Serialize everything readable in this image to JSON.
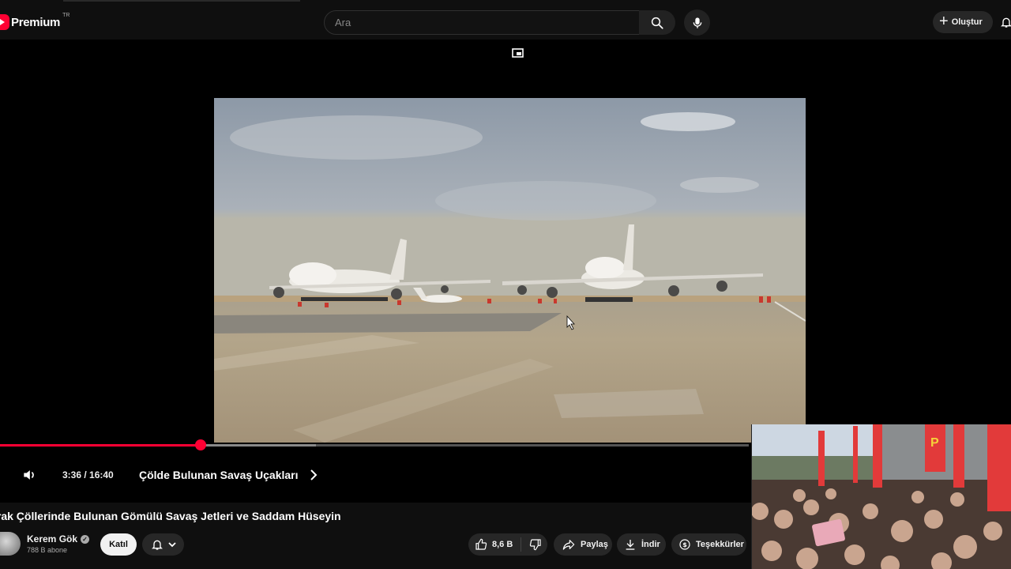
{
  "header": {
    "logo_text": "Premium",
    "region": "TR",
    "search_placeholder": "Ara",
    "create_label": "Oluştur"
  },
  "player": {
    "current_time": "3:36",
    "duration": "16:40",
    "time_display": "3:36 / 16:40",
    "progress_fraction": 0.216,
    "chapter_title": "Çölde Bulunan Savaş Uçakları"
  },
  "video": {
    "title": "Irak Çöllerinde Bulunan Gömülü Savaş Jetleri ve Saddam Hüseyin",
    "channel_name": "Kerem Gök",
    "subscribers": "788 B abone",
    "join_label": "Katıl",
    "like_count": "8,6 B",
    "share_label": "Paylaş",
    "download_label": "İndir",
    "thanks_label": "Teşekkürler"
  },
  "colors": {
    "accent": "#ff0033",
    "background": "#0f0f0f",
    "pill": "#272727"
  },
  "icons": {
    "logo": "youtube-play-icon",
    "search": "search-icon",
    "mic": "mic-icon",
    "create": "plus-icon",
    "bell": "bell-icon",
    "miniplayer": "miniplayer-icon",
    "volume": "volume-icon",
    "chapter_next": "chevron-right-icon",
    "like": "thumbs-up-icon",
    "dislike": "thumbs-down-icon",
    "share": "share-icon",
    "download": "download-icon",
    "thanks": "thanks-icon"
  }
}
